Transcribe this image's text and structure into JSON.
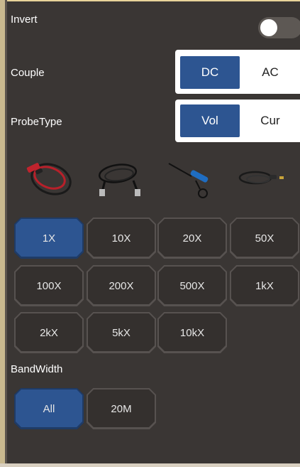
{
  "invert": {
    "label": "Invert",
    "enabled": false
  },
  "couple": {
    "label": "Couple",
    "options": [
      "DC",
      "AC"
    ],
    "selected": "DC"
  },
  "probe_type": {
    "label": "ProbeType",
    "options": [
      "Vol",
      "Cur"
    ],
    "selected": "Vol"
  },
  "probe_images": [
    "red-probe-cable-icon",
    "black-clip-probe-icon",
    "blue-pen-probe-icon",
    "current-clamp-cable-icon"
  ],
  "attenuation": {
    "options": [
      "1X",
      "10X",
      "20X",
      "50X",
      "100X",
      "200X",
      "500X",
      "1kX",
      "2kX",
      "5kX",
      "10kX"
    ],
    "selected": "1X"
  },
  "bandwidth": {
    "label": "BandWidth",
    "options": [
      "All",
      "20M"
    ],
    "selected": "All"
  },
  "colors": {
    "accent": "#2d5591",
    "panel": "#3a3634",
    "button": "#34302e"
  }
}
